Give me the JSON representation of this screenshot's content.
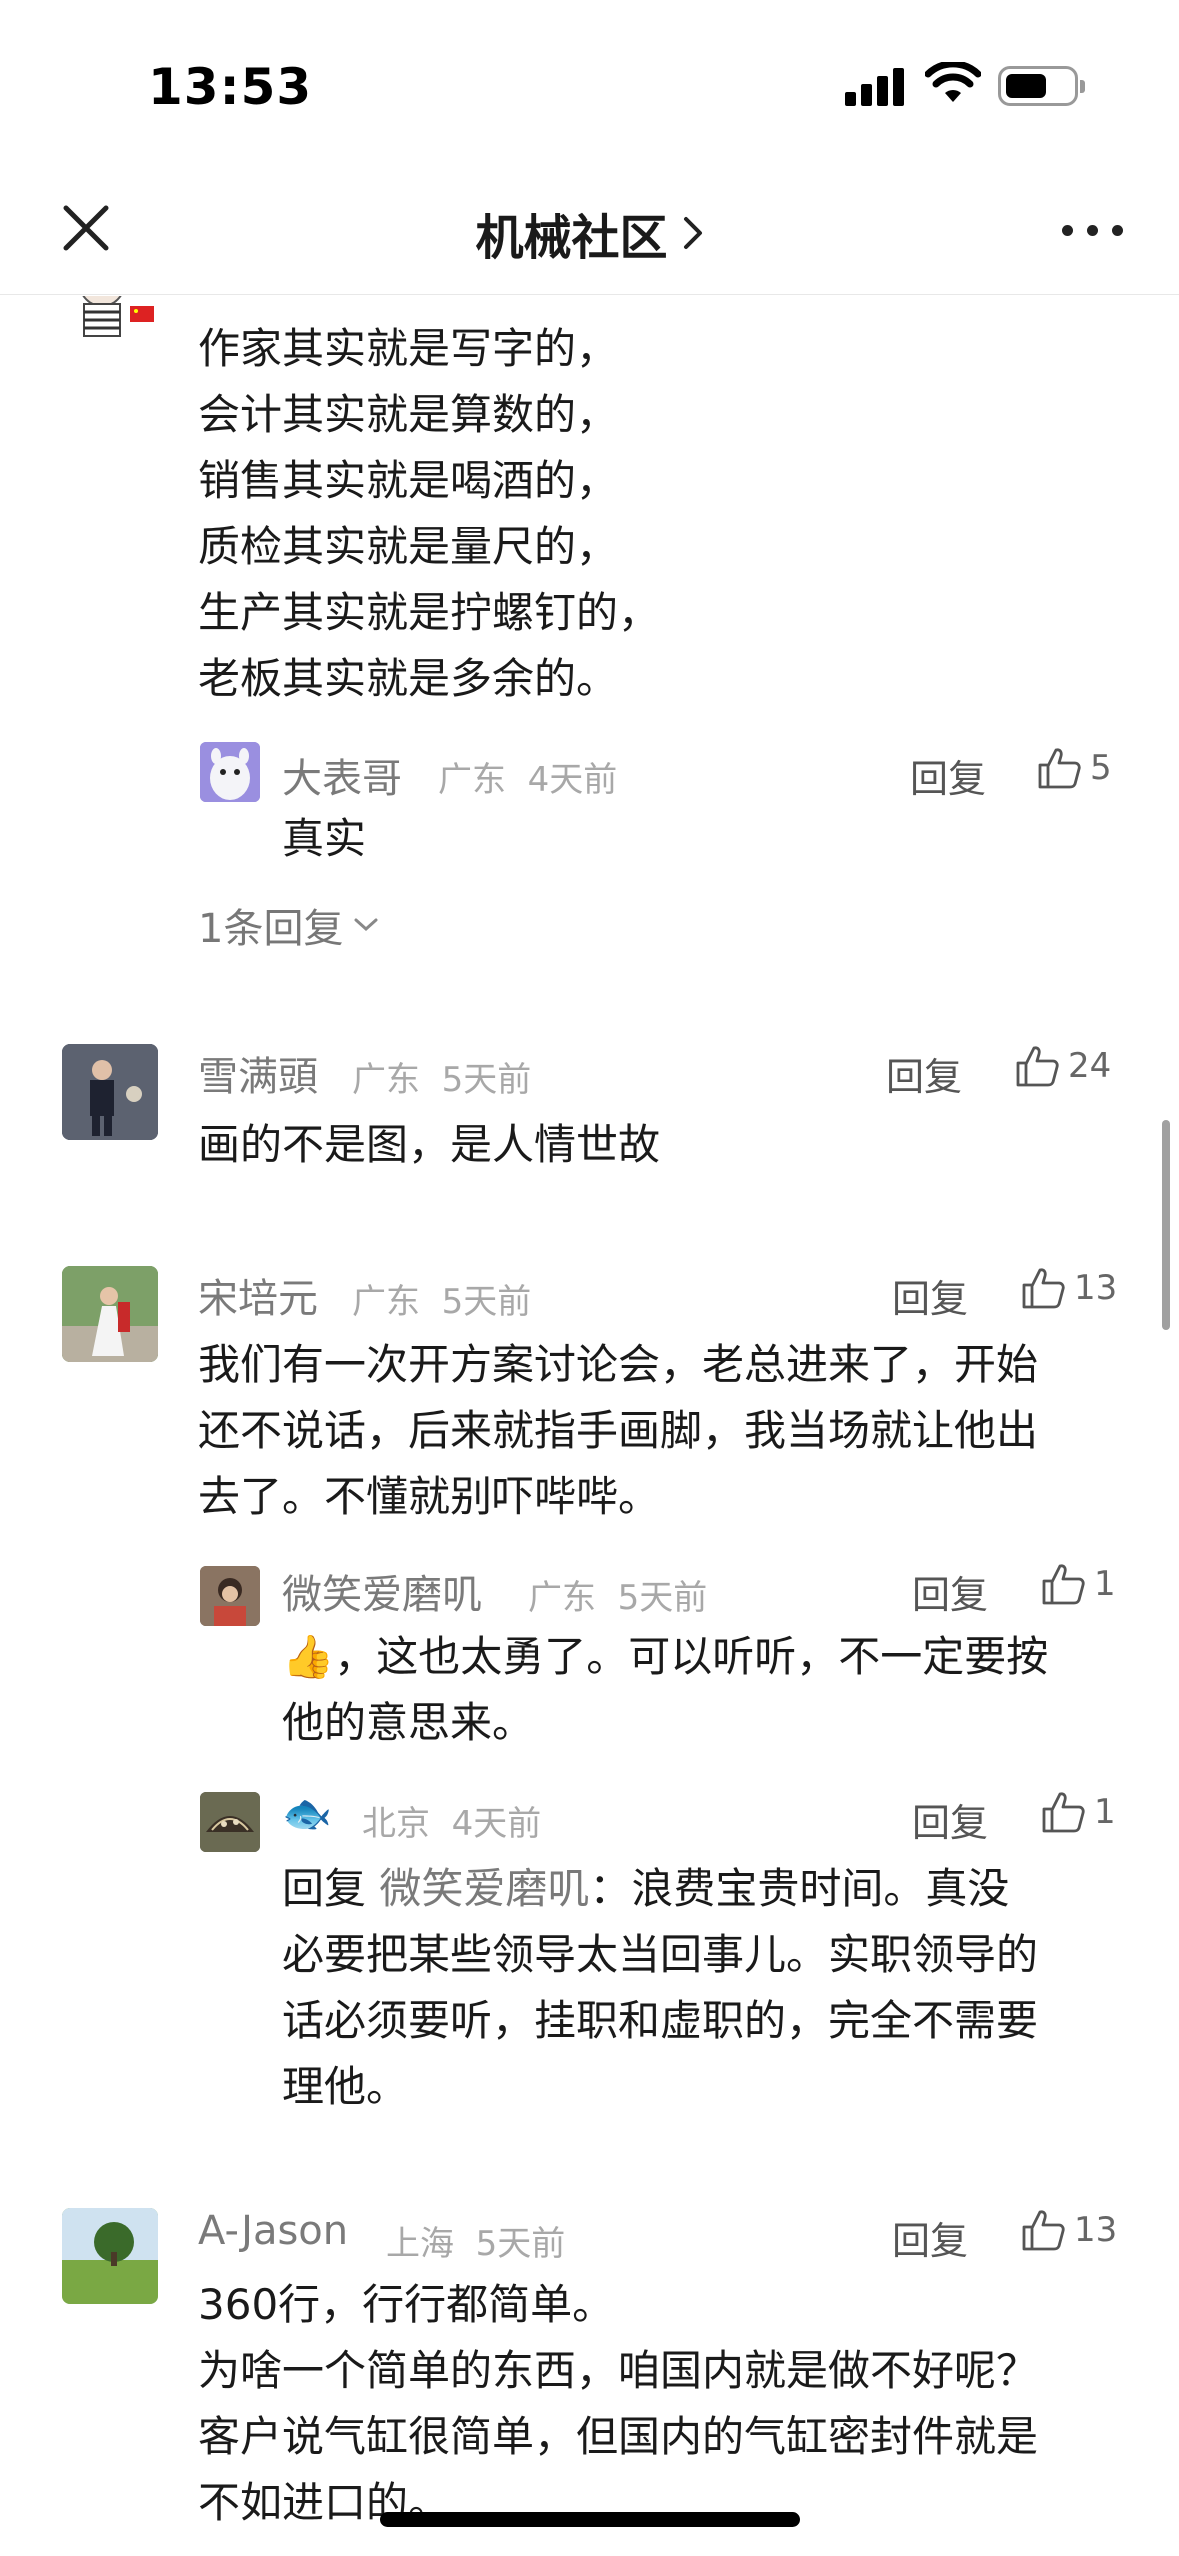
{
  "status": {
    "time": "13:53"
  },
  "nav": {
    "title": "机械社区"
  },
  "comments": [
    {
      "lines": [
        "作家其实就是写字的，",
        "会计其实就是算数的，",
        "销售其实就是喝酒的，",
        "质检其实就是量尺的，",
        "生产其实就是拧螺钉的，",
        "老板其实就是多余的。"
      ],
      "replies": [
        {
          "name": "大表哥",
          "location": "广东",
          "time": "4天前",
          "reply_label": "回复",
          "likes": "5",
          "text": "真实"
        }
      ],
      "more_replies": "1条回复"
    },
    {
      "name": "雪满頭",
      "location": "广东",
      "time": "5天前",
      "reply_label": "回复",
      "likes": "24",
      "lines": [
        "画的不是图，是人情世故"
      ]
    },
    {
      "name": "宋培元",
      "location": "广东",
      "time": "5天前",
      "reply_label": "回复",
      "likes": "13",
      "lines": [
        "我们有一次开方案讨论会，老总进来了，开始",
        "还不说话，后来就指手画脚，我当场就让他出",
        "去了。不懂就别吓哔哔。"
      ],
      "replies": [
        {
          "name": "微笑爱磨叽",
          "location": "广东",
          "time": "5天前",
          "reply_label": "回复",
          "likes": "1",
          "lines": [
            "👍，这也太勇了。可以听听，不一定要按",
            "他的意思来。"
          ]
        },
        {
          "name": "🐟",
          "location": "北京",
          "time": "4天前",
          "reply_label": "回复",
          "likes": "1",
          "reply_prefix": "回复 ",
          "mention": "微笑爱磨叽",
          "first_line_rest": "：浪费宝贵时间。真没",
          "lines": [
            "必要把某些领导太当回事儿。实职领导的",
            "话必须要听，挂职和虚职的，完全不需要",
            "理他。"
          ]
        }
      ]
    },
    {
      "name": "A-Jason",
      "location": "上海",
      "time": "5天前",
      "reply_label": "回复",
      "likes": "13",
      "lines": [
        "360行，行行都简单。",
        "为啥一个简单的东西，咱国内就是做不好呢？",
        "客户说气缸很简单，但国内的气缸密封件就是",
        "不如进口的。"
      ]
    }
  ]
}
